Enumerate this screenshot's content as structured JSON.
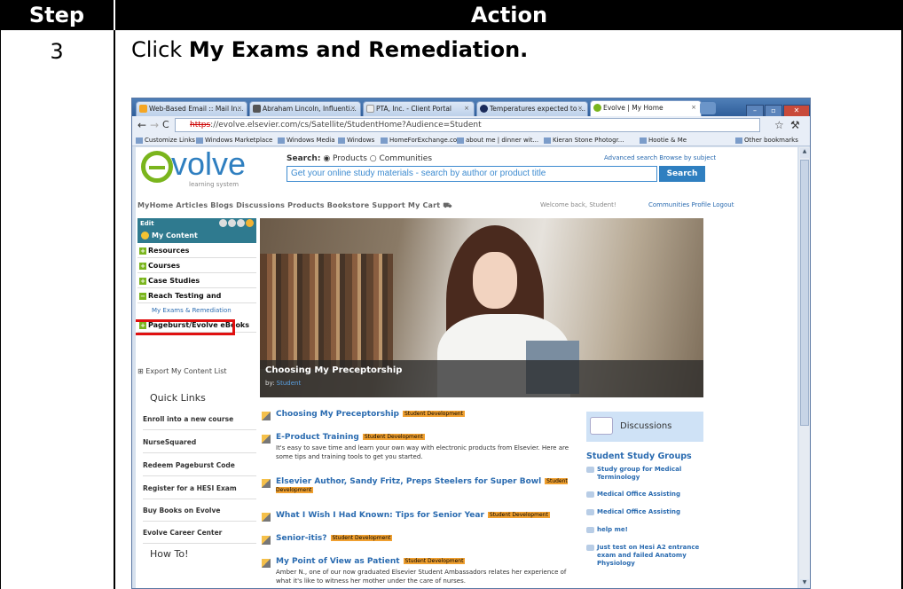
{
  "table": {
    "step_header": "Step",
    "action_header": "Action",
    "step_number": "3",
    "instruction_prefix": "Click ",
    "instruction_bold": "My Exams and Remediation."
  },
  "browser": {
    "tabs": [
      {
        "label": "Web-Based Email :: Mail In..."
      },
      {
        "label": "Abraham Lincoln, Influenti..."
      },
      {
        "label": "PTA, Inc. - Client Portal"
      },
      {
        "label": "Temperatures expected to ..."
      },
      {
        "label": "Evolve | My Home"
      }
    ],
    "url_scheme": "https",
    "url_rest": "://evolve.elsevier.com/cs/Satellite/StudentHome?Audience=Student",
    "bookmarks": [
      "Customize Links",
      "Windows Marketplace",
      "Windows Media",
      "Windows",
      "HomeForExchange.com",
      "about me | dinner wit...",
      "Kieran Stone Photogr...",
      "Hootie & Me",
      "Other bookmarks"
    ]
  },
  "page": {
    "logo_text": "volve",
    "logo_sub": "learning system",
    "search_label": "Search:",
    "search_opt1": "Products",
    "search_opt2": "Communities",
    "advanced": "Advanced search  Browse by subject",
    "search_placeholder": "Get your online study materials - search by author or product title",
    "search_button": "Search",
    "topnav": "MyHome  Articles  Blogs  Discussions  Products  Bookstore  Support  My Cart",
    "welcome": "Welcome back, Student!",
    "comm_links": "Communities  Profile  Logout",
    "sidebar": {
      "edit": "Edit",
      "my_content": "My Content",
      "items": [
        "Resources",
        "Courses",
        "Case Studies",
        "Reach Testing and"
      ],
      "sub_item": "My Exams & Remediation",
      "last_item": "Pageburst/Evolve eBooks",
      "export": "Export My Content List",
      "quick_links": "Quick Links",
      "links": [
        "Enroll into a new course",
        "NurseSquared",
        "Redeem Pageburst Code",
        "Register for a HESI Exam",
        "Buy Books on Evolve",
        "Evolve Career Center"
      ],
      "how_to": "How To!"
    },
    "hero_title": "Choosing My Preceptorship",
    "hero_by": "by:",
    "hero_author": "Student",
    "feed": [
      {
        "title": "Choosing My Preceptorship",
        "tag": "Student Development",
        "desc": ""
      },
      {
        "title": "E-Product Training",
        "tag": "Student Development",
        "desc": "It's easy to save time and learn your own way with electronic products from Elsevier. Here are some tips and training tools to get you started."
      },
      {
        "title": "Elsevier Author, Sandy Fritz, Preps Steelers for Super Bowl",
        "tag": "Student Development",
        "desc": ""
      },
      {
        "title": "What I Wish I Had Known: Tips for Senior Year",
        "tag": "Student Development",
        "desc": ""
      },
      {
        "title": "Senior-itis?",
        "tag": "Student Development",
        "desc": ""
      },
      {
        "title": "My Point of View as Patient",
        "tag": "Student Development",
        "desc": "Amber N., one of our now graduated Elsevier Student Ambassadors relates her experience of what it's like to witness her mother under the care of nurses."
      }
    ],
    "discussions": "Discussions",
    "study_groups": "Student Study Groups",
    "groups": [
      "Study group for Medical Terminology",
      "Medical Office Assisting",
      "Medical Office Assisting",
      "help me!",
      "Just test on Hesi A2 entrance exam and failed Anatomy Physiology"
    ]
  }
}
